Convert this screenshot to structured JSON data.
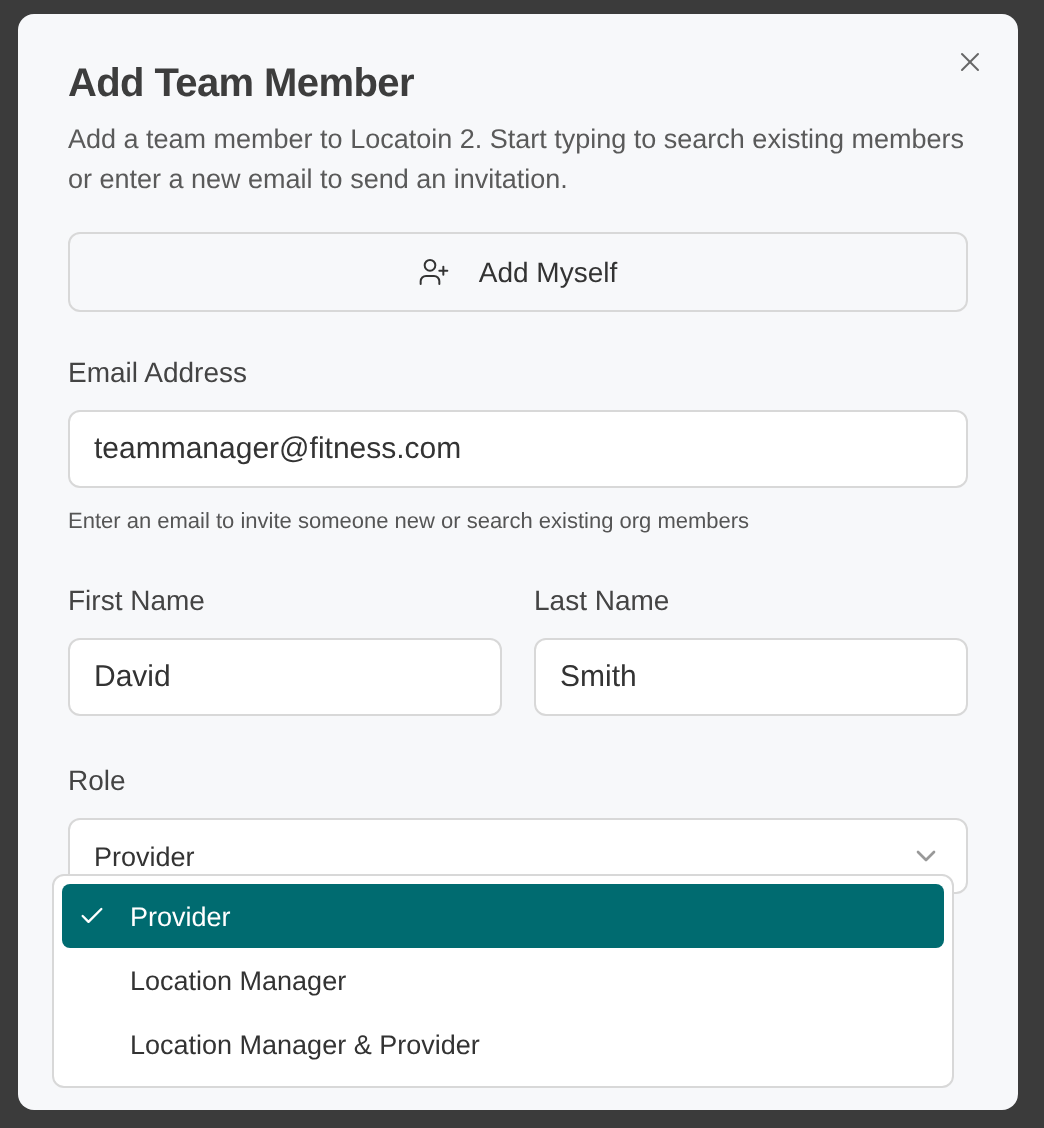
{
  "dialog": {
    "title": "Add Team Member",
    "description": "Add a team member to Locatoin 2. Start typing to search existing members or enter a new email to send an invitation.",
    "add_myself_button": "Add Myself",
    "email": {
      "label": "Email Address",
      "value": "teammanager@fitness.com",
      "hint": "Enter an email to invite someone new or search existing org members"
    },
    "first_name": {
      "label": "First Name",
      "value": "David"
    },
    "last_name": {
      "label": "Last Name",
      "value": "Smith"
    },
    "role": {
      "label": "Role",
      "value": "Provider",
      "expanded": true,
      "options": [
        {
          "label": "Provider",
          "selected": true
        },
        {
          "label": "Location Manager",
          "selected": false
        },
        {
          "label": "Location Manager & Provider",
          "selected": false
        }
      ]
    }
  }
}
